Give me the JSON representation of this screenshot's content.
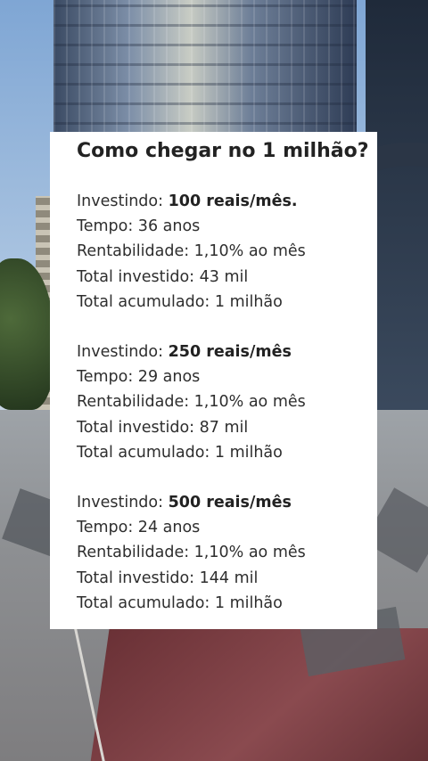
{
  "card": {
    "title": "Como chegar no 1 milhão?",
    "scenarios": [
      {
        "investing_label": "Investindo:",
        "investing_value": "100 reais/mês.",
        "time": "Tempo: 36 anos",
        "return": "Rentabilidade: 1,10% ao mês",
        "total_invested": "Total investido: 43 mil",
        "total_accumulated": "Total acumulado: 1 milhão"
      },
      {
        "investing_label": "Investindo:",
        "investing_value": "250 reais/mês",
        "time": "Tempo: 29 anos",
        "return": "Rentabilidade: 1,10% ao mês",
        "total_invested": "Total investido: 87 mil",
        "total_accumulated": "Total acumulado: 1 milhão"
      },
      {
        "investing_label": "Investindo:",
        "investing_value": "500 reais/mês",
        "time": "Tempo: 24 anos",
        "return": "Rentabilidade: 1,10% ao mês",
        "total_invested": "Total investido: 144 mil",
        "total_accumulated": "Total acumulado: 1 milhão"
      }
    ]
  },
  "colors": {
    "card_background": "#ffffff",
    "text": "#2e2e2e",
    "title": "#222222"
  }
}
